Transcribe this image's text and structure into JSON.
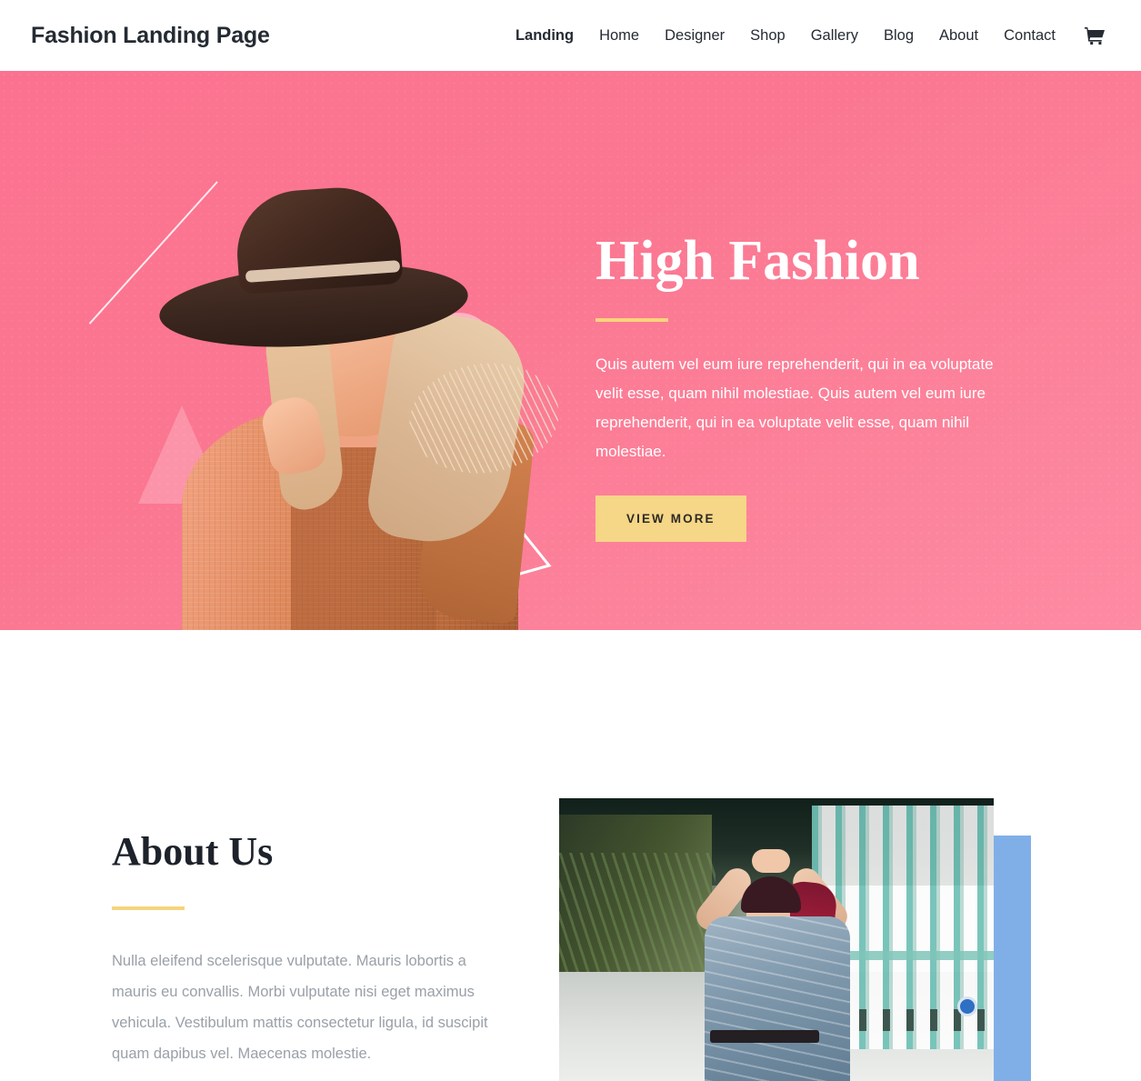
{
  "header": {
    "brand": "Fashion Landing Page",
    "nav_items": [
      {
        "label": "Landing",
        "active": true
      },
      {
        "label": "Home",
        "active": false
      },
      {
        "label": "Designer",
        "active": false
      },
      {
        "label": "Shop",
        "active": false
      },
      {
        "label": "Gallery",
        "active": false
      },
      {
        "label": "Blog",
        "active": false
      },
      {
        "label": "About",
        "active": false
      },
      {
        "label": "Contact",
        "active": false
      }
    ],
    "cart_icon": "shopping-cart-icon"
  },
  "hero": {
    "title": "High Fashion",
    "paragraph": "Quis autem vel eum iure reprehenderit, qui in ea voluptate velit esse, quam nihil molestiae. Quis autem vel eum iure reprehenderit, qui in ea voluptate velit esse, quam nihil molestiae.",
    "button_label": "VIEW MORE",
    "image_alt": "Woman wearing wide-brim dark fedora hat and orange knit sweater",
    "decorations": [
      "diagonal-line",
      "circle-outline",
      "pink-triangle",
      "white-triangle",
      "diagonal-lines"
    ]
  },
  "about": {
    "title": "About Us",
    "paragraph": "Nulla eleifend scelerisque vulputate. Mauris lobortis a mauris eu convallis. Morbi vulputate nisi eget maximus vehicula. Vestibulum mattis consectetur ligula, id suscipit quam dapibus vel. Maecenas molestie.",
    "image_alt": "Woman with red hair in blue embroidered kimono standing in a pillared corridor"
  },
  "colors": {
    "hero_pink_start": "#fb7290",
    "hero_pink_end": "#fd8ba3",
    "accent_yellow": "#f6d47c",
    "button_yellow": "#f6d687",
    "text_dark": "#252b33",
    "text_muted": "#9aa0a8",
    "block_blue": "#80afe8"
  }
}
